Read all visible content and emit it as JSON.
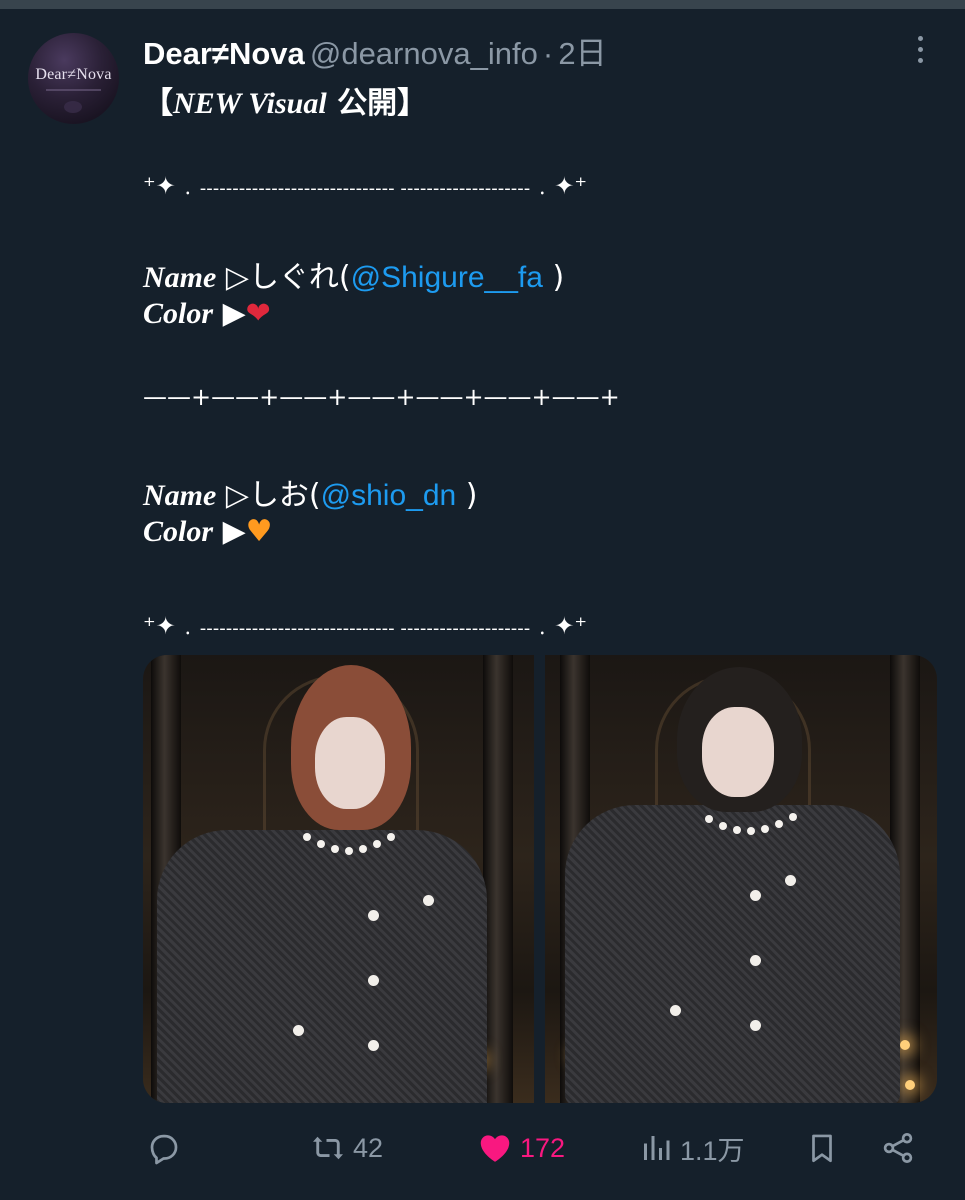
{
  "tweet": {
    "avatar_text": "Dear≠Nova",
    "display_name": "Dear≠Nova",
    "handle": "@dearnova_info",
    "separator": "·",
    "time": "2日",
    "lines": {
      "announce_open": "【",
      "announce_title": "NEW Visual",
      "announce_jp": " 公開",
      "announce_close": "】",
      "deco_left": "⁺✦﹒",
      "dashes": "------------------------------ --------------------",
      "deco_right": "﹒✦⁺",
      "name1_label": "Name",
      "name1_arrow": " ▷",
      "name1_text": "しぐれ(",
      "name1_mention": "@Shigure__fa",
      "name1_close": " )",
      "color_label": "Color",
      "color_arrow": " ▶",
      "heart1": "❤",
      "divider": "——+——+——+——+——+——+——+",
      "name2_label": "Name",
      "name2_arrow": " ▷",
      "name2_text": "しお(",
      "name2_mention": "@shio_dn",
      "name2_close": " )",
      "color2_label": "Color",
      "color2_arrow": " ▶",
      "heart2": "♥"
    },
    "media": [
      {
        "alt": "photo-shigure",
        "accent": "#8a4d38"
      },
      {
        "alt": "photo-shio",
        "accent": "#24201e"
      }
    ],
    "actions": {
      "reply": {
        "icon": "reply-icon",
        "count": ""
      },
      "retweet": {
        "icon": "retweet-icon",
        "count": "42"
      },
      "like": {
        "icon": "heart-icon",
        "count": "172",
        "liked": true,
        "color": "#f91880"
      },
      "views": {
        "icon": "views-icon",
        "count": "1.1万"
      },
      "bookmark": {
        "icon": "bookmark-icon"
      },
      "share": {
        "icon": "share-icon"
      }
    }
  },
  "colors": {
    "background": "#15202b",
    "mention": "#1d9bf0",
    "secondary": "#8b98a5",
    "like": "#f91880"
  }
}
